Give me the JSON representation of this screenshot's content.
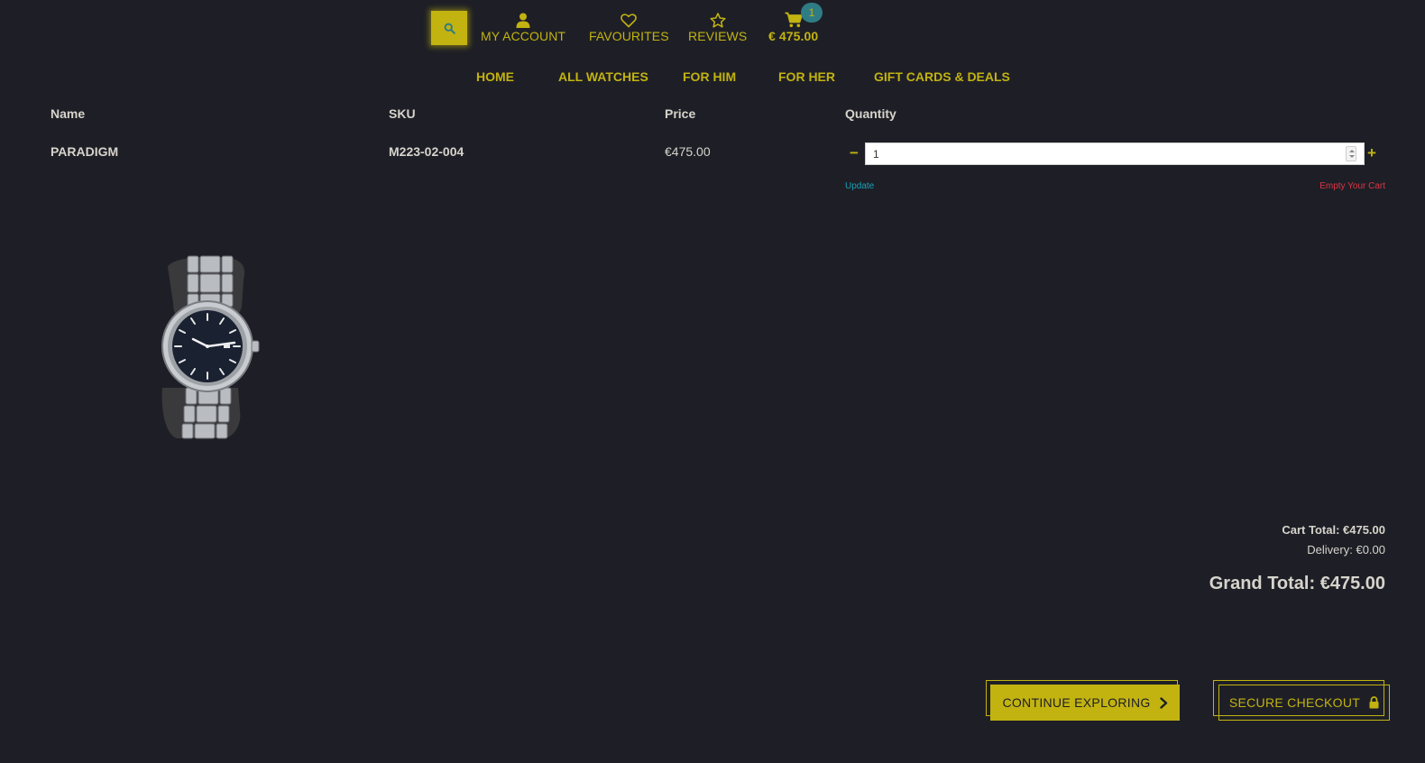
{
  "header": {
    "search": {
      "icon": "search-icon"
    },
    "utility": [
      {
        "label": "MY ACCOUNT",
        "icon": "user-icon"
      },
      {
        "label": "FAVOURITES",
        "icon": "heart-icon"
      },
      {
        "label": "REVIEWS",
        "icon": "star-icon"
      },
      {
        "label": "€ 475.00",
        "icon": "cart-icon"
      }
    ],
    "cart_badge": "1"
  },
  "nav": {
    "items": [
      "HOME",
      "ALL WATCHES",
      "FOR HIM",
      "FOR HER",
      "GIFT CARDS & DEALS"
    ]
  },
  "cart": {
    "columns": [
      "Name",
      "SKU",
      "Price",
      "Quantity"
    ],
    "rows": [
      {
        "name": "PARADIGM",
        "sku": "M223-02-004",
        "price": "€475.00",
        "quantity": "1"
      }
    ],
    "update_label": "Update",
    "empty_label": "Empty Your Cart"
  },
  "totals": {
    "cart_total": "Cart Total: €475.00",
    "delivery": "Delivery: €0.00",
    "grand_total": "Grand Total: €475.00"
  },
  "actions": {
    "continue_label": "CONTINUE EXPLORING",
    "checkout_label": "SECURE CHECKOUT"
  },
  "colors": {
    "background": "#1e1f26",
    "accent": "#c2b311",
    "text": "#d7d4cc",
    "update_link": "#17a2b8",
    "empty_link": "#dc3545",
    "badge": "#2f7c85"
  }
}
